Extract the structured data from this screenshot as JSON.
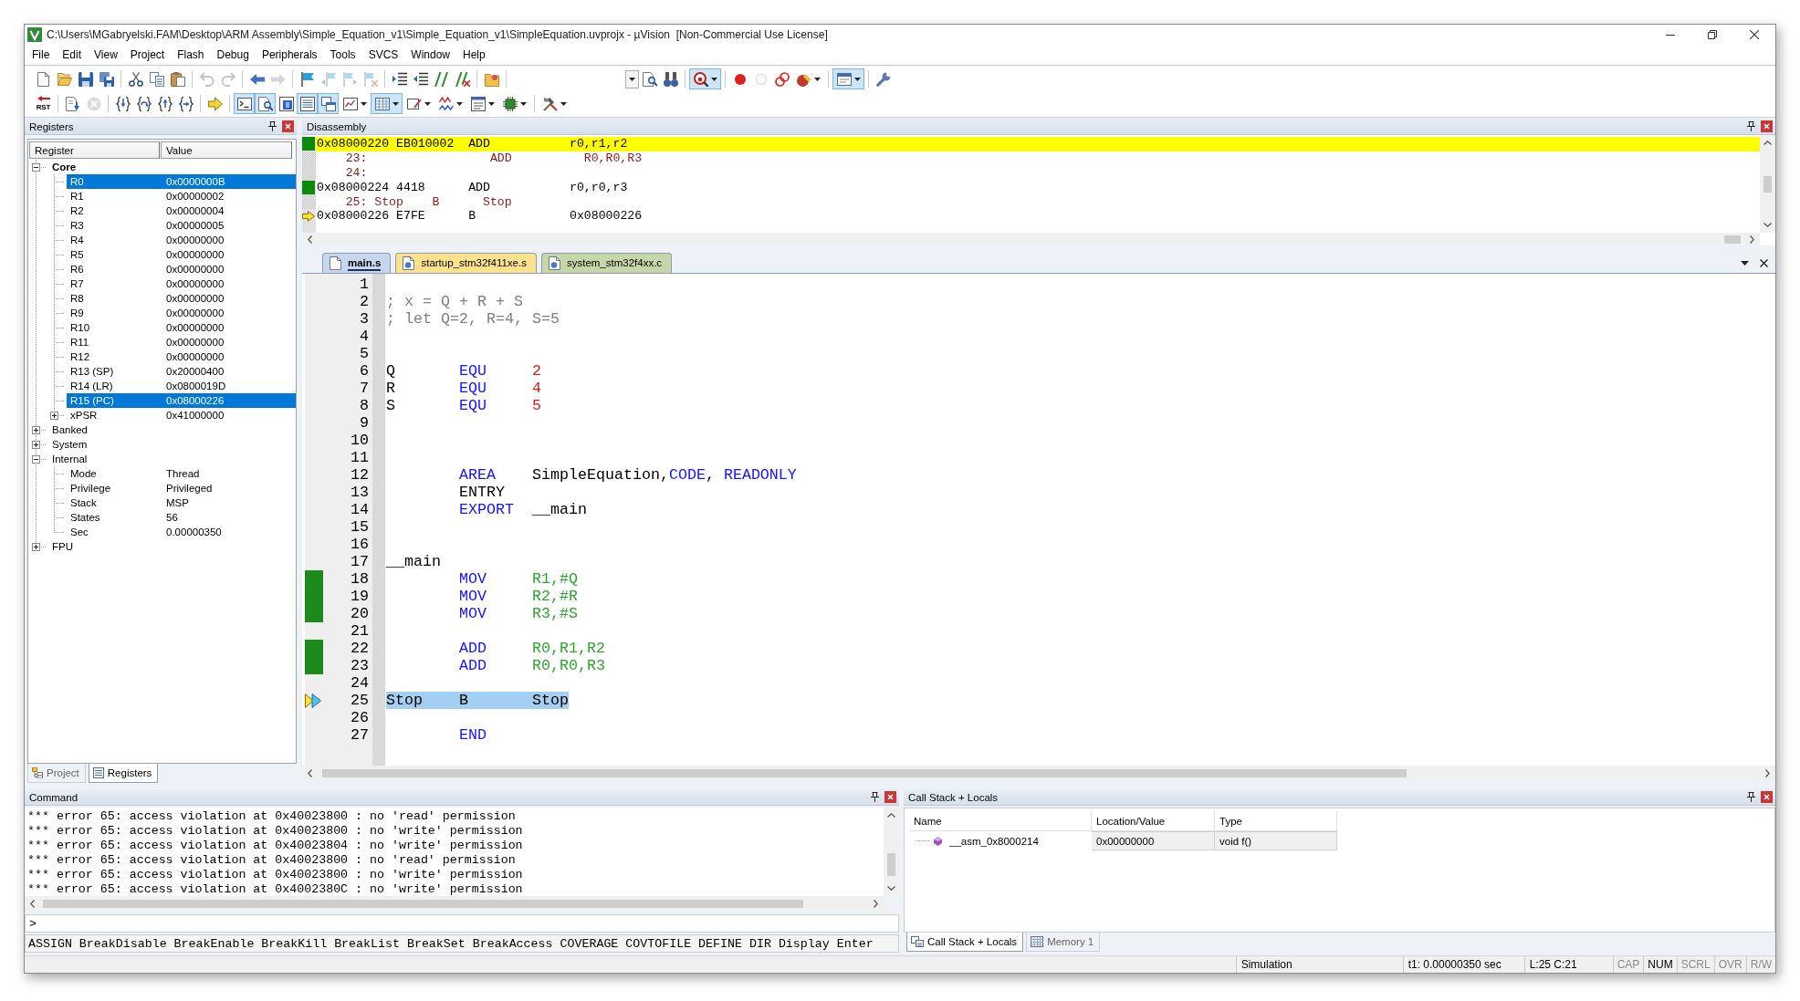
{
  "window": {
    "title": "C:\\Users\\MGabryelski.FAM\\Desktop\\ARM Assembly\\Simple_Equation_v1\\Simple_Equation_v1\\SimpleEquation.uvprojx - µVision  [Non-Commercial Use License]"
  },
  "menu": [
    "File",
    "Edit",
    "View",
    "Project",
    "Flash",
    "Debug",
    "Peripherals",
    "Tools",
    "SVCS",
    "Window",
    "Help"
  ],
  "toolbar_1": [
    [
      {
        "kind": "button",
        "pressed": false,
        "disabled": false,
        "dropdown": false
      },
      {
        "kind": "button",
        "pressed": false,
        "disabled": false,
        "dropdown": false
      },
      {
        "kind": "button",
        "pressed": false,
        "disabled": false,
        "dropdown": false
      },
      {
        "kind": "button",
        "pressed": false,
        "disabled": false,
        "dropdown": false
      }
    ],
    [
      {
        "kind": "button",
        "pressed": false,
        "disabled": false,
        "dropdown": false
      },
      {
        "kind": "button",
        "pressed": false,
        "disabled": false,
        "dropdown": false
      },
      {
        "kind": "button",
        "pressed": false,
        "disabled": false,
        "dropdown": false
      }
    ],
    [
      {
        "kind": "button",
        "pressed": false,
        "disabled": true,
        "dropdown": false
      },
      {
        "kind": "button",
        "pressed": false,
        "disabled": true,
        "dropdown": false
      }
    ],
    [
      {
        "kind": "button",
        "pressed": false,
        "disabled": false,
        "dropdown": false
      },
      {
        "kind": "button",
        "pressed": false,
        "disabled": true,
        "dropdown": false
      }
    ],
    [
      {
        "kind": "button",
        "pressed": false,
        "disabled": false,
        "dropdown": false
      },
      {
        "kind": "button",
        "pressed": false,
        "disabled": true,
        "dropdown": false
      },
      {
        "kind": "button",
        "pressed": false,
        "disabled": true,
        "dropdown": false
      },
      {
        "kind": "button",
        "pressed": false,
        "disabled": true,
        "dropdown": false
      }
    ],
    [
      {
        "kind": "button",
        "pressed": false,
        "disabled": false,
        "dropdown": false
      },
      {
        "kind": "button",
        "pressed": false,
        "disabled": false,
        "dropdown": false
      },
      {
        "kind": "button",
        "pressed": false,
        "disabled": false,
        "dropdown": false
      },
      {
        "kind": "button",
        "pressed": false,
        "disabled": false,
        "dropdown": false
      }
    ],
    [
      {
        "kind": "button",
        "pressed": false,
        "disabled": false,
        "dropdown": false
      }
    ],
    [
      {
        "kind": "combo"
      },
      {
        "kind": "button",
        "pressed": false,
        "disabled": false,
        "dropdown": false
      },
      {
        "kind": "button",
        "pressed": false,
        "disabled": false,
        "dropdown": false
      }
    ],
    [
      {
        "kind": "button",
        "pressed": true,
        "disabled": false,
        "dropdown": true
      }
    ],
    [
      {
        "kind": "button",
        "pressed": false,
        "disabled": false,
        "dropdown": false
      },
      {
        "kind": "button",
        "pressed": false,
        "disabled": true,
        "dropdown": false
      },
      {
        "kind": "button",
        "pressed": false,
        "disabled": false,
        "dropdown": false
      },
      {
        "kind": "button",
        "pressed": false,
        "disabled": false,
        "dropdown": true
      }
    ],
    [
      {
        "kind": "button",
        "pressed": true,
        "disabled": false,
        "dropdown": true
      }
    ],
    [
      {
        "kind": "button",
        "pressed": false,
        "disabled": false,
        "dropdown": false
      }
    ]
  ],
  "toolbar_2": [
    [
      {
        "kind": "button",
        "label": "RST",
        "pressed": false,
        "disabled": false,
        "dropdown": false
      }
    ],
    [
      {
        "kind": "button",
        "pressed": false,
        "disabled": false,
        "dropdown": false
      },
      {
        "kind": "button",
        "pressed": false,
        "disabled": true,
        "dropdown": false
      }
    ],
    [
      {
        "kind": "button",
        "pressed": false,
        "disabled": false,
        "dropdown": false
      },
      {
        "kind": "button",
        "pressed": false,
        "disabled": false,
        "dropdown": false
      },
      {
        "kind": "button",
        "pressed": false,
        "disabled": false,
        "dropdown": false
      },
      {
        "kind": "button",
        "pressed": false,
        "disabled": false,
        "dropdown": false
      }
    ],
    [
      {
        "kind": "button",
        "pressed": false,
        "disabled": false,
        "dropdown": false
      }
    ],
    [
      {
        "kind": "button",
        "pressed": true,
        "disabled": false,
        "dropdown": false
      },
      {
        "kind": "button",
        "pressed": true,
        "disabled": false,
        "dropdown": false
      },
      {
        "kind": "button",
        "pressed": false,
        "disabled": false,
        "dropdown": false
      },
      {
        "kind": "button",
        "pressed": true,
        "disabled": false,
        "dropdown": false
      },
      {
        "kind": "button",
        "pressed": true,
        "disabled": false,
        "dropdown": false
      },
      {
        "kind": "button",
        "pressed": false,
        "disabled": false,
        "dropdown": true
      },
      {
        "kind": "button",
        "pressed": true,
        "disabled": false,
        "dropdown": true
      },
      {
        "kind": "button",
        "pressed": false,
        "disabled": false,
        "dropdown": true
      },
      {
        "kind": "button",
        "pressed": false,
        "disabled": false,
        "dropdown": true
      },
      {
        "kind": "button",
        "pressed": false,
        "disabled": false,
        "dropdown": true
      },
      {
        "kind": "button",
        "pressed": false,
        "disabled": false,
        "dropdown": true
      }
    ],
    [
      {
        "kind": "button",
        "pressed": false,
        "disabled": false,
        "dropdown": true
      }
    ]
  ],
  "registers": {
    "title": "Registers",
    "columns": [
      "Register",
      "Value"
    ],
    "tree": [
      {
        "name": "Core",
        "emphasized": true,
        "expanded": true,
        "highlighted": false,
        "children": [
          {
            "name": "R0",
            "value": "0x0000000B",
            "highlighted": true
          },
          {
            "name": "R1",
            "value": "0x00000002",
            "highlighted": false
          },
          {
            "name": "R2",
            "value": "0x00000004",
            "highlighted": false
          },
          {
            "name": "R3",
            "value": "0x00000005",
            "highlighted": false
          },
          {
            "name": "R4",
            "value": "0x00000000",
            "highlighted": false
          },
          {
            "name": "R5",
            "value": "0x00000000",
            "highlighted": false
          },
          {
            "name": "R6",
            "value": "0x00000000",
            "highlighted": false
          },
          {
            "name": "R7",
            "value": "0x00000000",
            "highlighted": false
          },
          {
            "name": "R8",
            "value": "0x00000000",
            "highlighted": false
          },
          {
            "name": "R9",
            "value": "0x00000000",
            "highlighted": false
          },
          {
            "name": "R10",
            "value": "0x00000000",
            "highlighted": false
          },
          {
            "name": "R11",
            "value": "0x00000000",
            "highlighted": false
          },
          {
            "name": "R12",
            "value": "0x00000000",
            "highlighted": false
          },
          {
            "name": "R13 (SP)",
            "value": "0x20000400",
            "highlighted": false
          },
          {
            "name": "R14 (LR)",
            "value": "0x0800019D",
            "highlighted": false
          },
          {
            "name": "R15 (PC)",
            "value": "0x08000226",
            "highlighted": true
          },
          {
            "name": "xPSR",
            "value": "0x41000000",
            "highlighted": false,
            "expanded": false
          }
        ]
      },
      {
        "name": "Banked",
        "emphasized": false,
        "expanded": false,
        "highlighted": false
      },
      {
        "name": "System",
        "emphasized": false,
        "expanded": false,
        "highlighted": false
      },
      {
        "name": "Internal",
        "emphasized": false,
        "expanded": true,
        "highlighted": false,
        "children": [
          {
            "name": "Mode",
            "value": "Thread",
            "highlighted": false
          },
          {
            "name": "Privilege",
            "value": "Privileged",
            "highlighted": false
          },
          {
            "name": "Stack",
            "value": "MSP",
            "highlighted": false
          },
          {
            "name": "States",
            "value": "56",
            "highlighted": false
          },
          {
            "name": "Sec",
            "value": "0.00000350",
            "highlighted": false
          }
        ]
      },
      {
        "name": "FPU",
        "emphasized": false,
        "expanded": false,
        "highlighted": false
      }
    ],
    "tabs": [
      {
        "label": "Project",
        "selected": false
      },
      {
        "label": "Registers",
        "selected": true
      }
    ]
  },
  "disassembly": {
    "title": "Disassembly",
    "lines": [
      {
        "kind": "instruction",
        "text": "0x08000220 EB010002  ADD           r0,r1,r2",
        "executed": true,
        "pc": false,
        "highlighted": true
      },
      {
        "kind": "source",
        "text": "23:                 ADD          R0,R0,R3",
        "executed": false,
        "pc": false,
        "highlighted": false
      },
      {
        "kind": "source",
        "text": "24:",
        "executed": false,
        "pc": false,
        "highlighted": false
      },
      {
        "kind": "instruction",
        "text": "0x08000224 4418      ADD           r0,r0,r3",
        "executed": true,
        "pc": false,
        "highlighted": false
      },
      {
        "kind": "source",
        "text": "25: Stop    B      Stop",
        "executed": false,
        "pc": false,
        "highlighted": false
      },
      {
        "kind": "instruction",
        "text": "0x08000226 E7FE      B             0x08000226",
        "executed": false,
        "pc": true,
        "highlighted": false
      }
    ]
  },
  "editor": {
    "tabs": [
      {
        "label": "main.s",
        "selected": true,
        "color": "#c6d6ee"
      },
      {
        "label": "startup_stm32f411xe.s",
        "selected": false,
        "color": "#fde28e"
      },
      {
        "label": "system_stm32f4xx.c",
        "selected": false,
        "color": "#c7d6a8"
      }
    ],
    "lines": [
      {
        "number": "1",
        "executed": false,
        "current": false
      },
      {
        "number": "2",
        "executed": false,
        "current": false,
        "comment": "; x = Q + R + S"
      },
      {
        "number": "3",
        "executed": false,
        "current": false,
        "comment": "; let Q=2, R=4, S=5"
      },
      {
        "number": "4",
        "executed": false,
        "current": false
      },
      {
        "number": "5",
        "executed": false,
        "current": false
      },
      {
        "number": "6",
        "executed": false,
        "current": false,
        "label": "Q",
        "op": {
          "text": "EQU",
          "kind": "keyword"
        },
        "args": [
          {
            "text": "2",
            "kind": "number"
          }
        ]
      },
      {
        "number": "7",
        "executed": false,
        "current": false,
        "label": "R",
        "op": {
          "text": "EQU",
          "kind": "keyword"
        },
        "args": [
          {
            "text": "4",
            "kind": "number"
          }
        ]
      },
      {
        "number": "8",
        "executed": false,
        "current": false,
        "label": "S",
        "op": {
          "text": "EQU",
          "kind": "keyword"
        },
        "args": [
          {
            "text": "5",
            "kind": "number"
          }
        ]
      },
      {
        "number": "9",
        "executed": false,
        "current": false
      },
      {
        "number": "10",
        "executed": false,
        "current": false
      },
      {
        "number": "11",
        "executed": false,
        "current": false
      },
      {
        "number": "12",
        "executed": false,
        "current": false,
        "op": {
          "text": "AREA",
          "kind": "keyword"
        },
        "args": [
          {
            "text": "SimpleEquation,",
            "kind": "plain"
          },
          {
            "text": "CODE",
            "kind": "keyword"
          },
          {
            "text": ", ",
            "kind": "plain"
          },
          {
            "text": "READONLY",
            "kind": "keyword"
          }
        ]
      },
      {
        "number": "13",
        "executed": false,
        "current": false,
        "op": {
          "text": "ENTRY",
          "kind": "plain"
        }
      },
      {
        "number": "14",
        "executed": false,
        "current": false,
        "op": {
          "text": "EXPORT",
          "kind": "keyword"
        },
        "args": [
          {
            "text": "__main",
            "kind": "plain"
          }
        ]
      },
      {
        "number": "15",
        "executed": false,
        "current": false
      },
      {
        "number": "16",
        "executed": false,
        "current": false
      },
      {
        "number": "17",
        "executed": false,
        "current": false,
        "label": "__main"
      },
      {
        "number": "18",
        "executed": true,
        "current": false,
        "op": {
          "text": "MOV",
          "kind": "keyword"
        },
        "args": [
          {
            "text": "R1,#Q",
            "kind": "operand"
          }
        ]
      },
      {
        "number": "19",
        "executed": true,
        "current": false,
        "op": {
          "text": "MOV",
          "kind": "keyword"
        },
        "args": [
          {
            "text": "R2,#R",
            "kind": "operand"
          }
        ]
      },
      {
        "number": "20",
        "executed": true,
        "current": false,
        "op": {
          "text": "MOV",
          "kind": "keyword"
        },
        "args": [
          {
            "text": "R3,#S",
            "kind": "operand"
          }
        ]
      },
      {
        "number": "21",
        "executed": false,
        "current": false
      },
      {
        "number": "22",
        "executed": true,
        "current": false,
        "op": {
          "text": "ADD",
          "kind": "keyword"
        },
        "args": [
          {
            "text": "R0,R1,R2",
            "kind": "operand"
          }
        ]
      },
      {
        "number": "23",
        "executed": true,
        "current": false,
        "op": {
          "text": "ADD",
          "kind": "keyword"
        },
        "args": [
          {
            "text": "R0,R0,R3",
            "kind": "operand"
          }
        ]
      },
      {
        "number": "24",
        "executed": false,
        "current": false
      },
      {
        "number": "25",
        "executed": false,
        "current": true,
        "label": "Stop",
        "op": {
          "text": "B",
          "kind": "plain"
        },
        "args": [
          {
            "text": "Stop",
            "kind": "plain"
          }
        ]
      },
      {
        "number": "26",
        "executed": false,
        "current": false
      },
      {
        "number": "27",
        "executed": false,
        "current": false,
        "op": {
          "text": "END",
          "kind": "keyword"
        }
      }
    ]
  },
  "command": {
    "title": "Command",
    "output": [
      "*** error 65: access violation at 0x40023800 : no 'read' permission",
      "*** error 65: access violation at 0x40023800 : no 'write' permission",
      "*** error 65: access violation at 0x40023804 : no 'write' permission",
      "*** error 65: access violation at 0x40023800 : no 'read' permission",
      "*** error 65: access violation at 0x40023800 : no 'write' permission",
      "*** error 65: access violation at 0x4002380C : no 'write' permission"
    ],
    "prompt": ">",
    "hint": "ASSIGN BreakDisable BreakEnable BreakKill BreakList BreakSet BreakAccess COVERAGE COVTOFILE DEFINE DIR Display Enter"
  },
  "call_stack": {
    "title": "Call Stack + Locals",
    "columns": [
      "Name",
      "Location/Value",
      "Type"
    ],
    "rows": [
      {
        "name": "__asm_0x8000214",
        "location": "0x00000000",
        "type": "void f()"
      }
    ],
    "tabs": [
      {
        "label": "Call Stack + Locals",
        "selected": true
      },
      {
        "label": "Memory 1",
        "selected": false
      }
    ]
  },
  "status_bar": {
    "mode": "Simulation",
    "time": "t1: 0.00000350 sec",
    "position": "L:25 C:21",
    "indicators": [
      {
        "label": "CAP",
        "on": false
      },
      {
        "label": "NUM",
        "on": true
      },
      {
        "label": "SCRL",
        "on": false
      },
      {
        "label": "OVR",
        "on": false
      },
      {
        "label": "R/W",
        "on": false
      }
    ]
  }
}
